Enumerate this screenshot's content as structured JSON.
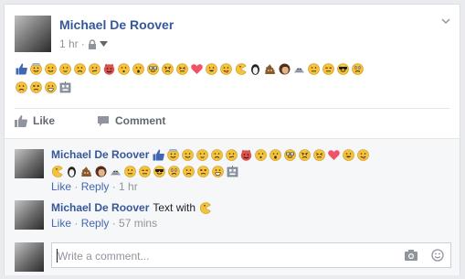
{
  "post": {
    "author": "Michael De Roover",
    "time": "1 hr",
    "emoji_row1": [
      "thumbs-up",
      "angel",
      "smile",
      "slight-smile",
      "frown",
      "confused",
      "devil",
      "kiss",
      "gasp",
      "glasses",
      "grumpy",
      "squint",
      "heart",
      "happy",
      "tongue",
      "pacman",
      "penguin",
      "poop",
      "chris-putnam",
      "shark",
      "neutral",
      "unsure",
      "sunglasses",
      "wide-eye"
    ],
    "emoji_row2": [
      "frown-2",
      "upset",
      "grin",
      "robot"
    ],
    "actions": {
      "like": "Like",
      "comment": "Comment"
    }
  },
  "comments": [
    {
      "author": "Michael De Roover",
      "text": "",
      "like": "Like",
      "reply": "Reply",
      "time": "1 hr",
      "emoji_line1": [
        "thumbs-up",
        "angel",
        "smile",
        "slight-smile",
        "frown",
        "confused",
        "devil",
        "kiss",
        "gasp",
        "glasses",
        "grumpy",
        "squint",
        "heart",
        "happy",
        "tongue"
      ],
      "emoji_line2": [
        "pacman",
        "penguin",
        "poop",
        "chris-putnam",
        "shark",
        "neutral",
        "unsure",
        "sunglasses",
        "wide-eye",
        "frown-2",
        "upset",
        "grin",
        "robot"
      ]
    },
    {
      "author": "Michael De Roover",
      "text": "Text with",
      "trailing_emoji": "pacman",
      "like": "Like",
      "reply": "Reply",
      "time": "57 mins"
    }
  ],
  "composer": {
    "placeholder": "Write a comment..."
  },
  "colors": {
    "name": "#365899",
    "link": "#4267b2",
    "meta": "#90949c",
    "emoji": "#f5c33b",
    "heart": "#f25268"
  }
}
